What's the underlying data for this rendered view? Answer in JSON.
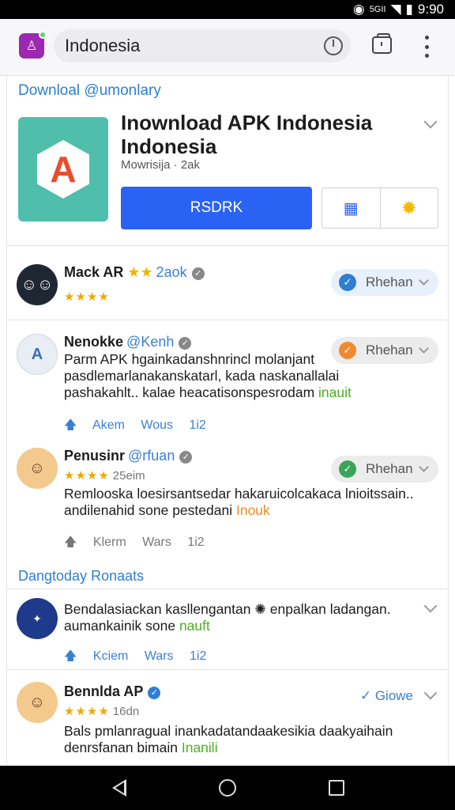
{
  "status_bar": {
    "network": "5GII",
    "time": "9:90"
  },
  "browser": {
    "url_text": "Indonesia"
  },
  "sections": {
    "download_title": "Downloal @umonlary",
    "related_title": "Dangtoday Ronaats"
  },
  "app": {
    "name": "Inownload APK Indonesia Indonesia",
    "meta": "Mowrisija · 2ak",
    "install_label": "RSDRK"
  },
  "reviews": [
    {
      "name": "Mack AR",
      "handle": "2aok",
      "stars": "★★★★",
      "pill": "Rhehan",
      "pill_color": "#2f7fd0"
    },
    {
      "name": "Nenokke",
      "handle": "@Kenh",
      "avatar_letter": "A",
      "pill": "Rhehan",
      "pill_color": "#f08a30",
      "text": "Parm APK hgainkadanshnrincl molanjant pasdlemarlanakanskatarl, kada naskanallalai pashakahlt.. kalae heacatisonspesrodam",
      "text_highlight": "inauit",
      "actions": [
        "Akem",
        "Wous",
        "1i2"
      ]
    },
    {
      "name": "Penusinr",
      "handle": "@rfuan",
      "stars": "★★★★",
      "meta": "25eim",
      "pill": "Rhehan",
      "pill_color": "#3aa55a",
      "text": "Remlooska loesirsantsedar hakaruicolcakaca lnioitssain.. andilenahid sone pestedani",
      "text_highlight": "Inouk",
      "actions": [
        "Klerm",
        "Wars",
        "1i2"
      ]
    }
  ],
  "related": [
    {
      "text": "Bendalasiackan kasllengantan ✺ enpalkan ladangan. aumankainik sone",
      "text_highlight": "nauft",
      "actions": [
        "Kciem",
        "Wars",
        "1i2"
      ]
    },
    {
      "name": "Bennlda AP",
      "stars": "★★★★",
      "meta": "16dn",
      "tag": "Giowe",
      "text": "Bals pmlanragual inankadatandaakesikia daakyaihain denrsfanan bimain",
      "text_highlight": "Inanili"
    }
  ]
}
